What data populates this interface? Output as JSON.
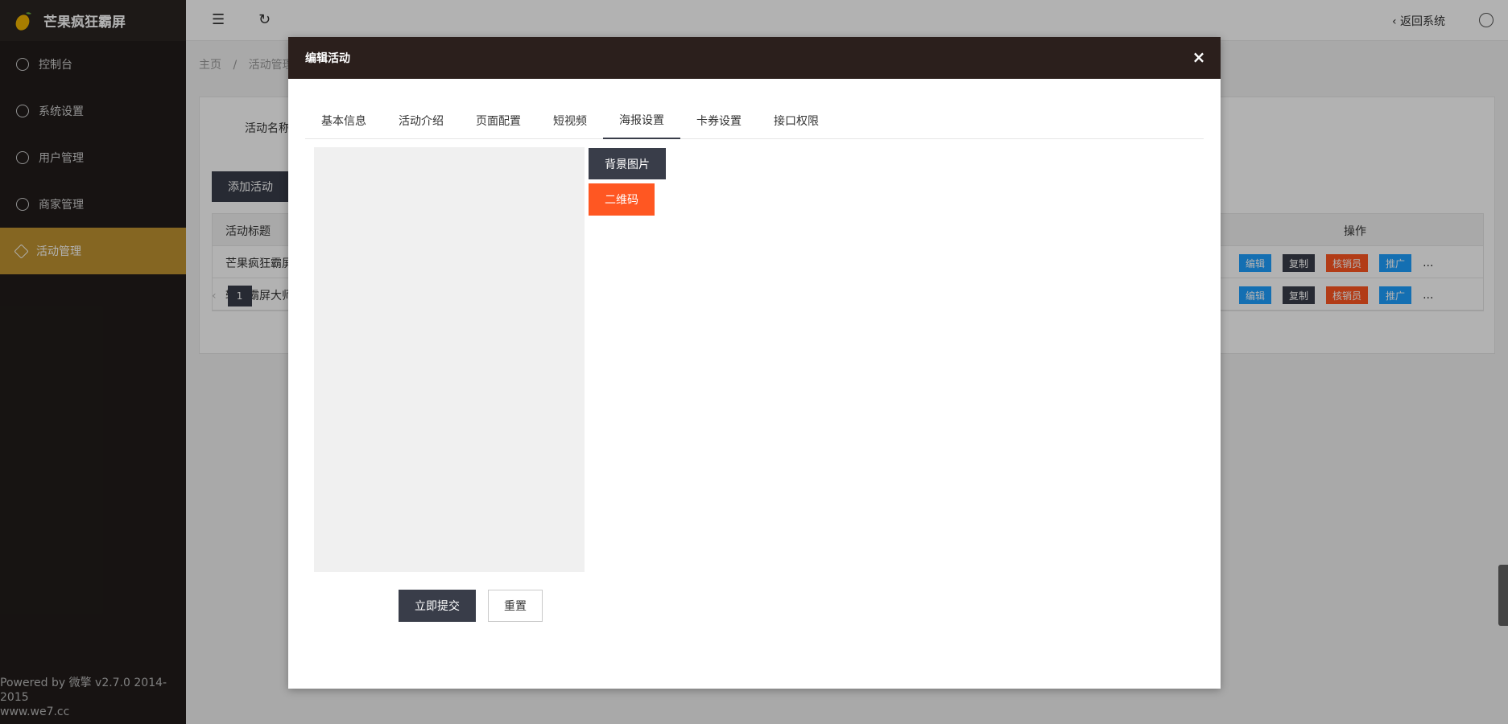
{
  "app": {
    "title": "芒果疯狂霸屏"
  },
  "sidebar": {
    "items": [
      {
        "label": "控制台",
        "icon": "dashboard-icon"
      },
      {
        "label": "系统设置",
        "icon": "gear-icon"
      },
      {
        "label": "用户管理",
        "icon": "user-icon"
      },
      {
        "label": "商家管理",
        "icon": "smile-icon"
      },
      {
        "label": "活动管理",
        "icon": "tag-icon",
        "active": true
      }
    ],
    "footer_line1": "Powered by 微擎 v2.7.0 2014-2015",
    "footer_line2": "www.we7.cc"
  },
  "header": {
    "back_label": "返回系统"
  },
  "breadcrumb": {
    "home": "主页",
    "sep": "/",
    "current": "活动管理"
  },
  "content": {
    "search_label": "活动名称",
    "add_button": "添加活动",
    "table": {
      "col_title": "活动标题",
      "col_ops": "操作",
      "rows": [
        {
          "title": "芒果疯狂霸屏"
        },
        {
          "title": "轻客霸屏大师"
        }
      ],
      "ops": {
        "edit": "编辑",
        "copy": "复制",
        "verifier": "核销员",
        "promote": "推广",
        "more": "..."
      }
    },
    "pager": {
      "page": "1"
    }
  },
  "modal": {
    "title": "编辑活动",
    "tabs": [
      "基本信息",
      "活动介绍",
      "页面配置",
      "短视频",
      "海报设置",
      "卡券设置",
      "接口权限"
    ],
    "active_tab": 4,
    "bg_image_button": "背景图片",
    "qr_button": "二维码",
    "submit_button": "立即提交",
    "reset_button": "重置"
  },
  "colors": {
    "accent": "#bf9331",
    "dark": "#393d49",
    "orange": "#ff5722",
    "blue": "#1e9fff",
    "modal_header": "#2b1f1c"
  }
}
